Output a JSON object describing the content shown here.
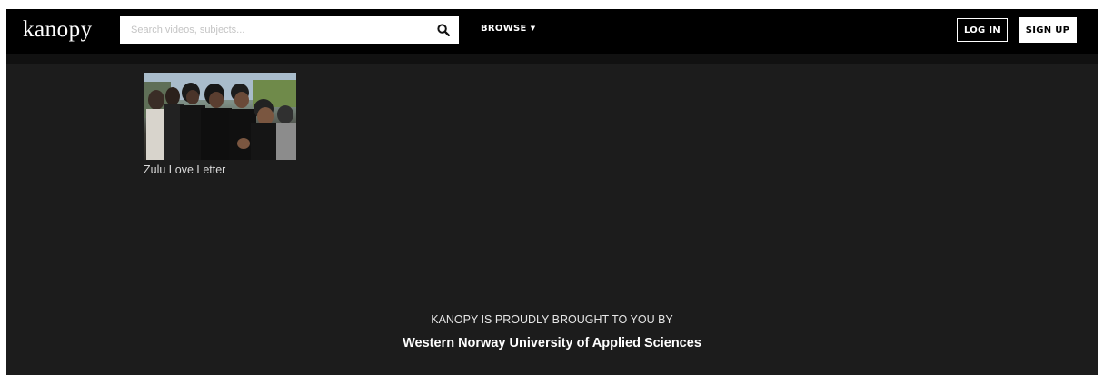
{
  "header": {
    "logo_text": "kanopy",
    "search": {
      "placeholder": "Search videos, subjects...",
      "value": "",
      "icon": "search-icon"
    },
    "browse_label": "BROWSE",
    "browse_icon": "caret-down-icon",
    "login_label": "LOG IN",
    "signup_label": "SIGN UP"
  },
  "results": [
    {
      "title": "Zulu Love Letter",
      "thumbnail": "film-still-thumbnail"
    }
  ],
  "footer": {
    "line1": "KANOPY IS PROUDLY BROUGHT TO YOU BY",
    "institution": "Western Norway University of Applied Sciences"
  },
  "colors": {
    "background": "#1c1c1c",
    "navbar": "#000000",
    "text": "#ffffff"
  }
}
